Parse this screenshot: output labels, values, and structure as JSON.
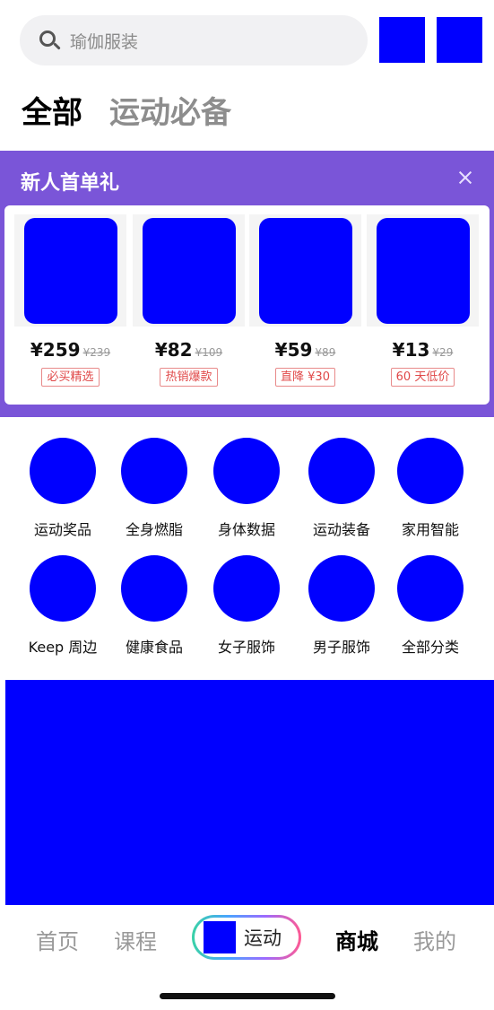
{
  "search": {
    "placeholder": "瑜伽服装"
  },
  "tabs": [
    {
      "label": "全部"
    },
    {
      "label": "运动必备"
    }
  ],
  "promo": {
    "title": "新人首单礼",
    "products": [
      {
        "price": "¥259",
        "old_price": "¥239",
        "tag": "必买精选"
      },
      {
        "price": "¥82",
        "old_price": "¥109",
        "tag": "热销爆款"
      },
      {
        "price": "¥59",
        "old_price": "¥89",
        "tag": "直降 ¥30"
      },
      {
        "price": "¥13",
        "old_price": "¥29",
        "tag": "60 天低价"
      }
    ]
  },
  "categories": [
    {
      "label": "运动奖品"
    },
    {
      "label": "全身燃脂"
    },
    {
      "label": "身体数据"
    },
    {
      "label": "运动装备"
    },
    {
      "label": "家用智能"
    },
    {
      "label": "Keep 周边"
    },
    {
      "label": "健康食品"
    },
    {
      "label": "女子服饰"
    },
    {
      "label": "男子服饰"
    },
    {
      "label": "全部分类"
    }
  ],
  "bottom_nav": {
    "home": "首页",
    "courses": "课程",
    "sport": "运动",
    "mall": "商城",
    "me": "我的"
  },
  "colors": {
    "promo_bg": "#7a55d8",
    "tab_underline": "#3fd0a8",
    "tag_red": "#e04848"
  },
  "icons": [
    "search-icon",
    "close-icon",
    "sport-icon"
  ]
}
